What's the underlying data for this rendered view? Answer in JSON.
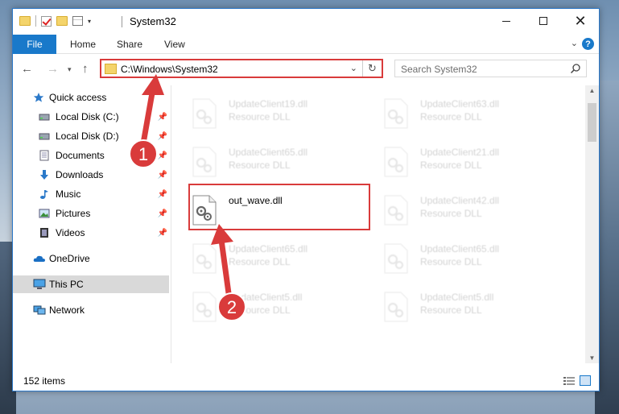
{
  "window": {
    "title": "System32",
    "close_symbol": "✕"
  },
  "ribbon": {
    "tabs": [
      "File",
      "Home",
      "Share",
      "View"
    ],
    "help_symbol": "?"
  },
  "navigation": {
    "address": "C:\\Windows\\System32",
    "search_placeholder": "Search System32"
  },
  "sidebar": {
    "items": [
      {
        "label": "Quick access",
        "icon": "star-icon"
      },
      {
        "label": "Local Disk (C:)",
        "icon": "drive-icon",
        "pinned": true
      },
      {
        "label": "Local Disk (D:)",
        "icon": "drive-icon",
        "pinned": true
      },
      {
        "label": "Documents",
        "icon": "documents-icon",
        "pinned": true
      },
      {
        "label": "Downloads",
        "icon": "download-icon",
        "pinned": true
      },
      {
        "label": "Music",
        "icon": "music-icon",
        "pinned": true
      },
      {
        "label": "Pictures",
        "icon": "pictures-icon",
        "pinned": true
      },
      {
        "label": "Videos",
        "icon": "videos-icon",
        "pinned": true
      },
      {
        "label": "OneDrive",
        "icon": "cloud-icon"
      },
      {
        "label": "This PC",
        "icon": "computer-icon",
        "selected": true
      },
      {
        "label": "Network",
        "icon": "network-icon"
      }
    ]
  },
  "files": {
    "left_column": [
      {
        "name": "UpdateClient19.dll",
        "type": "Resource DLL"
      },
      {
        "name": "UpdateClient65.dll",
        "type": "Resource DLL"
      },
      {
        "name": "out_wave.dll",
        "type": ""
      },
      {
        "name": "UpdateClient65.dll",
        "type": "Resource DLL"
      },
      {
        "name": "UpdateClient5.dll",
        "type": "Resource DLL"
      }
    ],
    "right_column": [
      {
        "name": "UpdateClient63.dll",
        "type": "Resource DLL"
      },
      {
        "name": "UpdateClient21.dll",
        "type": "Resource DLL"
      },
      {
        "name": "UpdateClient42.dll",
        "type": "Resource DLL"
      },
      {
        "name": "UpdateClient65.dll",
        "type": "Resource DLL"
      },
      {
        "name": "UpdateClient5.dll",
        "type": "Resource DLL"
      }
    ]
  },
  "status": {
    "item_count": "152 items"
  },
  "annotations": {
    "step1": "1",
    "step2": "2",
    "color": "#d93b3b"
  }
}
